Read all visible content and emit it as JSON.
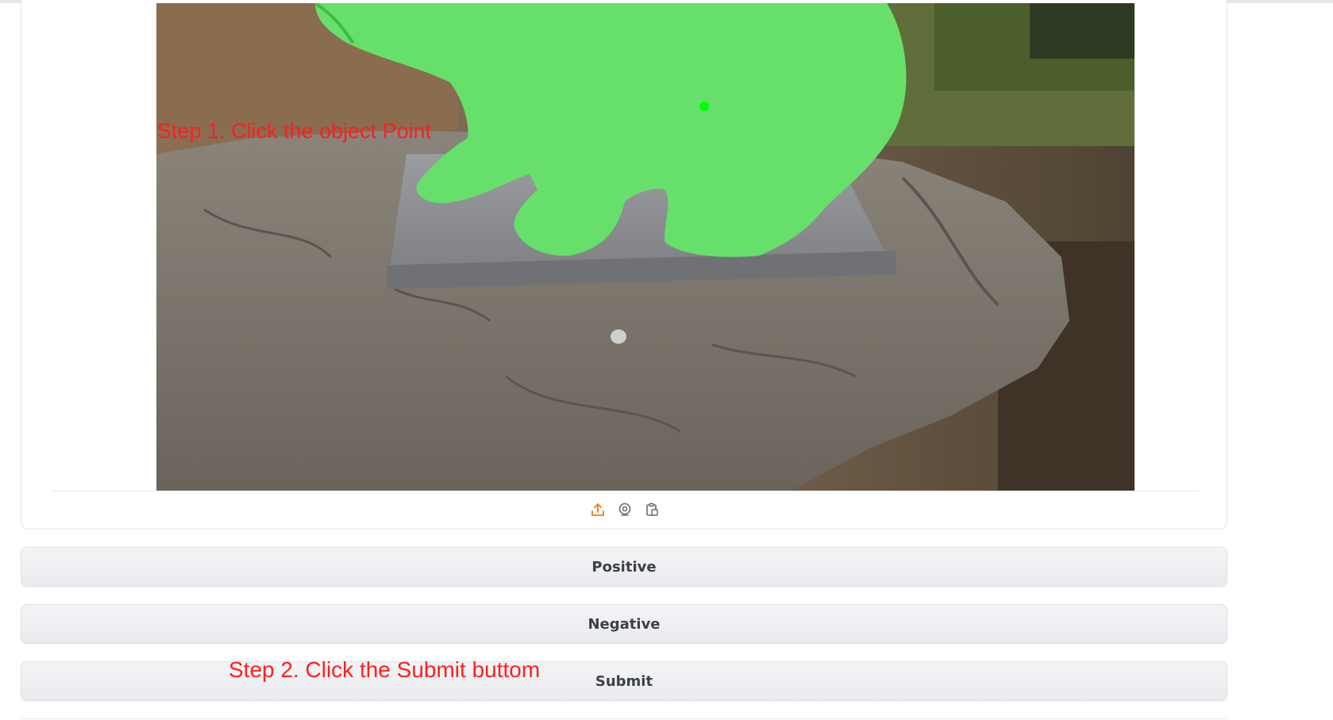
{
  "image_panel": {
    "annotation_step1": "Step 1. Click the object Point",
    "toolbar": {
      "upload_icon": "upload-icon",
      "webcam_icon": "webcam-icon",
      "clipboard_icon": "clipboard-paste-icon"
    }
  },
  "buttons": {
    "positive": "Positive",
    "negative": "Negative",
    "submit": "Submit"
  },
  "annotation_step2": "Step 2. Click the Submit buttom",
  "colors": {
    "annotation": "#ff1f1f",
    "mask": "#66e06a",
    "point": "#00ff00",
    "upload_icon": "#f08a24"
  }
}
